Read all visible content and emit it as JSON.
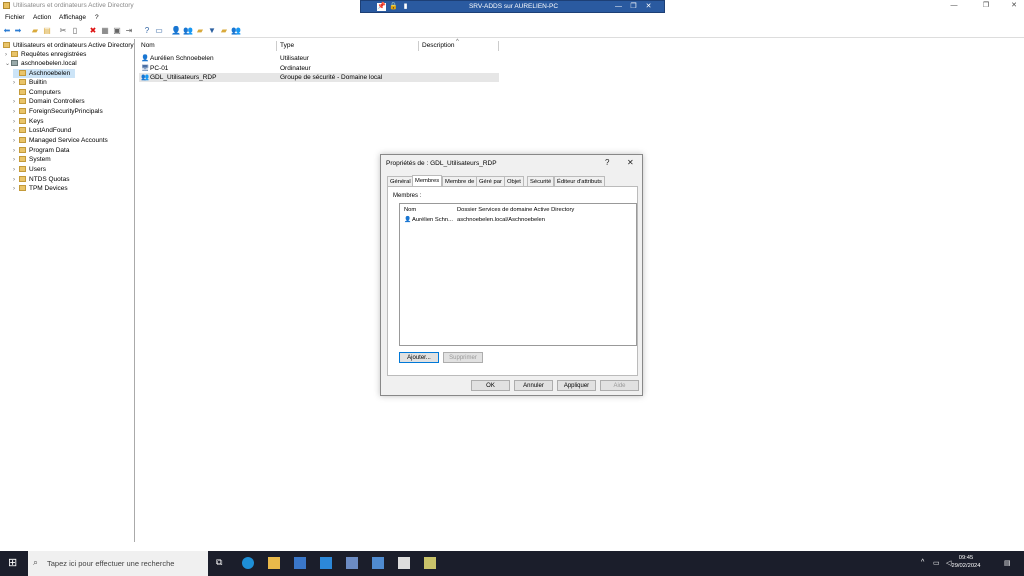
{
  "window": {
    "title": "Utilisateurs et ordinateurs Active Directory"
  },
  "rdp": {
    "title": "SRV-ADDS sur AURELIEN-PC"
  },
  "menu": [
    "Fichier",
    "Action",
    "Affichage",
    "?"
  ],
  "tree": {
    "root": "Utilisateurs et ordinateurs Active Directory",
    "saved": "Requêtes enregistrées",
    "domain": "aschnoebelen.local",
    "items": [
      "Aschnoebelen",
      "Builtin",
      "Computers",
      "Domain Controllers",
      "ForeignSecurityPrincipals",
      "Keys",
      "LostAndFound",
      "Managed Service Accounts",
      "Program Data",
      "System",
      "Users",
      "NTDS Quotas",
      "TPM Devices"
    ]
  },
  "list": {
    "headers": [
      "Nom",
      "Type",
      "Description"
    ],
    "rows": [
      {
        "name": "Aurélien Schnoebelen",
        "type": "Utilisateur",
        "icon": "user-icon"
      },
      {
        "name": "PC-01",
        "type": "Ordinateur",
        "icon": "computer-icon"
      },
      {
        "name": "GDL_Utilisateurs_RDP",
        "type": "Groupe de sécurité - Domaine local",
        "icon": "group-icon"
      }
    ]
  },
  "dialog": {
    "title": "Propriétés de : GDL_Utilisateurs_RDP",
    "help": "?",
    "close": "✕",
    "tabs": [
      "Général",
      "Membres",
      "Membre de",
      "Géré par",
      "Objet",
      "Sécurité",
      "Éditeur d'attributs"
    ],
    "members_label": "Membres :",
    "members_headers": [
      "Nom",
      "Dossier Services de domaine Active Directory"
    ],
    "members_rows": [
      {
        "name": "Aurélien Schn...",
        "folder": "aschnoebelen.local/Aschnoebelen"
      }
    ],
    "add": "Ajouter...",
    "remove": "Supprimer",
    "ok": "OK",
    "cancel": "Annuler",
    "apply": "Appliquer",
    "helpbtn": "Aide"
  },
  "taskbar": {
    "search_placeholder": "Tapez ici pour effectuer une recherche",
    "time": "09:45",
    "date": "29/02/2024"
  }
}
